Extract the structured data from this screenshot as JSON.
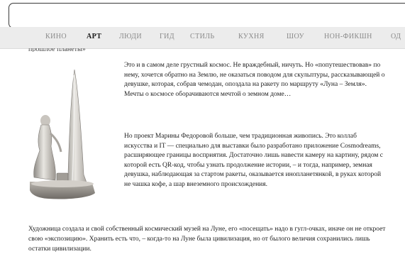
{
  "nav": {
    "items": [
      "КИНО",
      "АРТ",
      "ЛЮДИ",
      "ГИД",
      "СТИЛЬ",
      "КУХНЯ",
      "ШОУ",
      "НОН-ФИКШН",
      "ОД"
    ],
    "active": "АРТ"
  },
  "article": {
    "partial_line": "прошлое планеты»",
    "paragraph_1": "Это и в самом деле грустный космос. Не враждебный, ничуть. Но «попутешествовав» по нему, хочется обратно на Землю, не оказаться поводом для скульптуры, рассказывающей о девушке, которая, собрав чемодан, опоздала на ракету по маршруту «Луна – Земля». Мечты о космосе оборачиваются мечтой о земном доме…",
    "paragraph_2": "Но проект Марины Федоровой больше, чем традиционная живопись. Это коллаб искусства и IT — специально для выставки было разработано приложение Cosmodreams, расширяющее границы восприятия. Достаточно лишь навести камеру на картину, рядом с которой есть QR-код, чтобы узнать продолжение истории, – и тогда, например, земная девушка, наблюдающая за стартом ракеты, оказывается инопланетянкой, в руках которой не чашка кофе, а шар внеземного происхождения.",
    "paragraph_3": "Художница создала и свой собственный космический музей на Луне, его «посещать» надо в гугл-очках, иначе он не откроет свою «экспозицию». Хранить есть что, – когда-то на Луне была цивилизация, но от былого величия сохранились лишь остатки цивилизации."
  },
  "image": {
    "icon": "sculpture-rocket-girl"
  }
}
